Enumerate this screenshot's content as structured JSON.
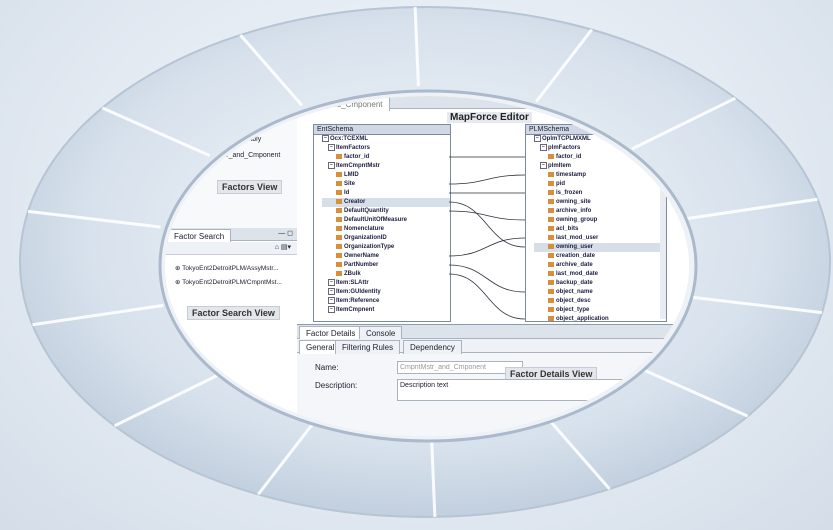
{
  "editor": {
    "tab_label": "Assy_and_Cmponent",
    "title": "MapForce Editor",
    "left_schema": {
      "title": "EntSchema",
      "nodes": [
        {
          "label": "Ocx:TCEXML",
          "type": "root"
        },
        {
          "label": "ItemFactors",
          "type": "branch"
        },
        {
          "label": "factor_id",
          "type": "leaf"
        },
        {
          "label": "ItemCmpntMstr",
          "type": "branch"
        },
        {
          "label": "LMID",
          "type": "leaf"
        },
        {
          "label": "Site",
          "type": "leaf"
        },
        {
          "label": "Id",
          "type": "leaf"
        },
        {
          "label": "Creator",
          "type": "leaf",
          "highlight": true
        },
        {
          "label": "DefaultQuantity",
          "type": "leaf"
        },
        {
          "label": "DefaultUnitOfMeasure",
          "type": "leaf"
        },
        {
          "label": "Nomenclature",
          "type": "leaf"
        },
        {
          "label": "OrganizationID",
          "type": "leaf"
        },
        {
          "label": "OrganizationType",
          "type": "leaf"
        },
        {
          "label": "OwnerName",
          "type": "leaf"
        },
        {
          "label": "PartNumber",
          "type": "leaf"
        },
        {
          "label": "ZBulk",
          "type": "leaf"
        },
        {
          "label": "Item:SLAttr",
          "type": "branch"
        },
        {
          "label": "Item:GUIdentity",
          "type": "branch"
        },
        {
          "label": "Item:Reference",
          "type": "branch"
        },
        {
          "label": "ItemCmpnent",
          "type": "branch"
        }
      ]
    },
    "right_schema": {
      "title": "PLMSchema",
      "nodes": [
        {
          "label": "OplmTCPLMXML",
          "type": "root"
        },
        {
          "label": "plmFactors",
          "type": "branch"
        },
        {
          "label": "factor_id",
          "type": "leaf"
        },
        {
          "label": "plmItem",
          "type": "branch"
        },
        {
          "label": "timestamp",
          "type": "leaf"
        },
        {
          "label": "pid",
          "type": "leaf"
        },
        {
          "label": "is_frozen",
          "type": "leaf"
        },
        {
          "label": "owning_site",
          "type": "leaf"
        },
        {
          "label": "archive_info",
          "type": "leaf"
        },
        {
          "label": "owning_group",
          "type": "leaf"
        },
        {
          "label": "acl_bits",
          "type": "leaf"
        },
        {
          "label": "last_mod_user",
          "type": "leaf"
        },
        {
          "label": "owning_user",
          "type": "leaf",
          "highlight": true
        },
        {
          "label": "creation_date",
          "type": "leaf"
        },
        {
          "label": "archive_date",
          "type": "leaf"
        },
        {
          "label": "last_mod_date",
          "type": "leaf"
        },
        {
          "label": "backup_date",
          "type": "leaf"
        },
        {
          "label": "object_name",
          "type": "leaf"
        },
        {
          "label": "object_desc",
          "type": "leaf"
        },
        {
          "label": "object_type",
          "type": "leaf"
        },
        {
          "label": "object_application",
          "type": "leaf"
        }
      ]
    }
  },
  "factors_view": {
    "items": [
      "_Assembly",
      "Mstr_and_Cmponent"
    ],
    "callout": "Factors View"
  },
  "factor_search": {
    "tab_label": "Factor Search",
    "results": [
      "TokyoEnt2DetroitPLM/AssyMstr...",
      "TokyoEnt2DetroitPLM/CmpntMst..."
    ],
    "callout": "Factor Search View"
  },
  "details": {
    "top_tabs": [
      "Factor Details",
      "Console"
    ],
    "sub_tabs": [
      "General",
      "Filtering Rules",
      "Dependency"
    ],
    "name_label": "Name:",
    "name_value": "CmpntMstr_and_Cmponent",
    "description_label": "Description:",
    "description_value": "Description text",
    "callout": "Factor Details View"
  },
  "colors": {
    "ring_segment": "#cfdbe8",
    "accent_blue": "#2b5a9c",
    "tab_strip": "#dde3ea"
  }
}
